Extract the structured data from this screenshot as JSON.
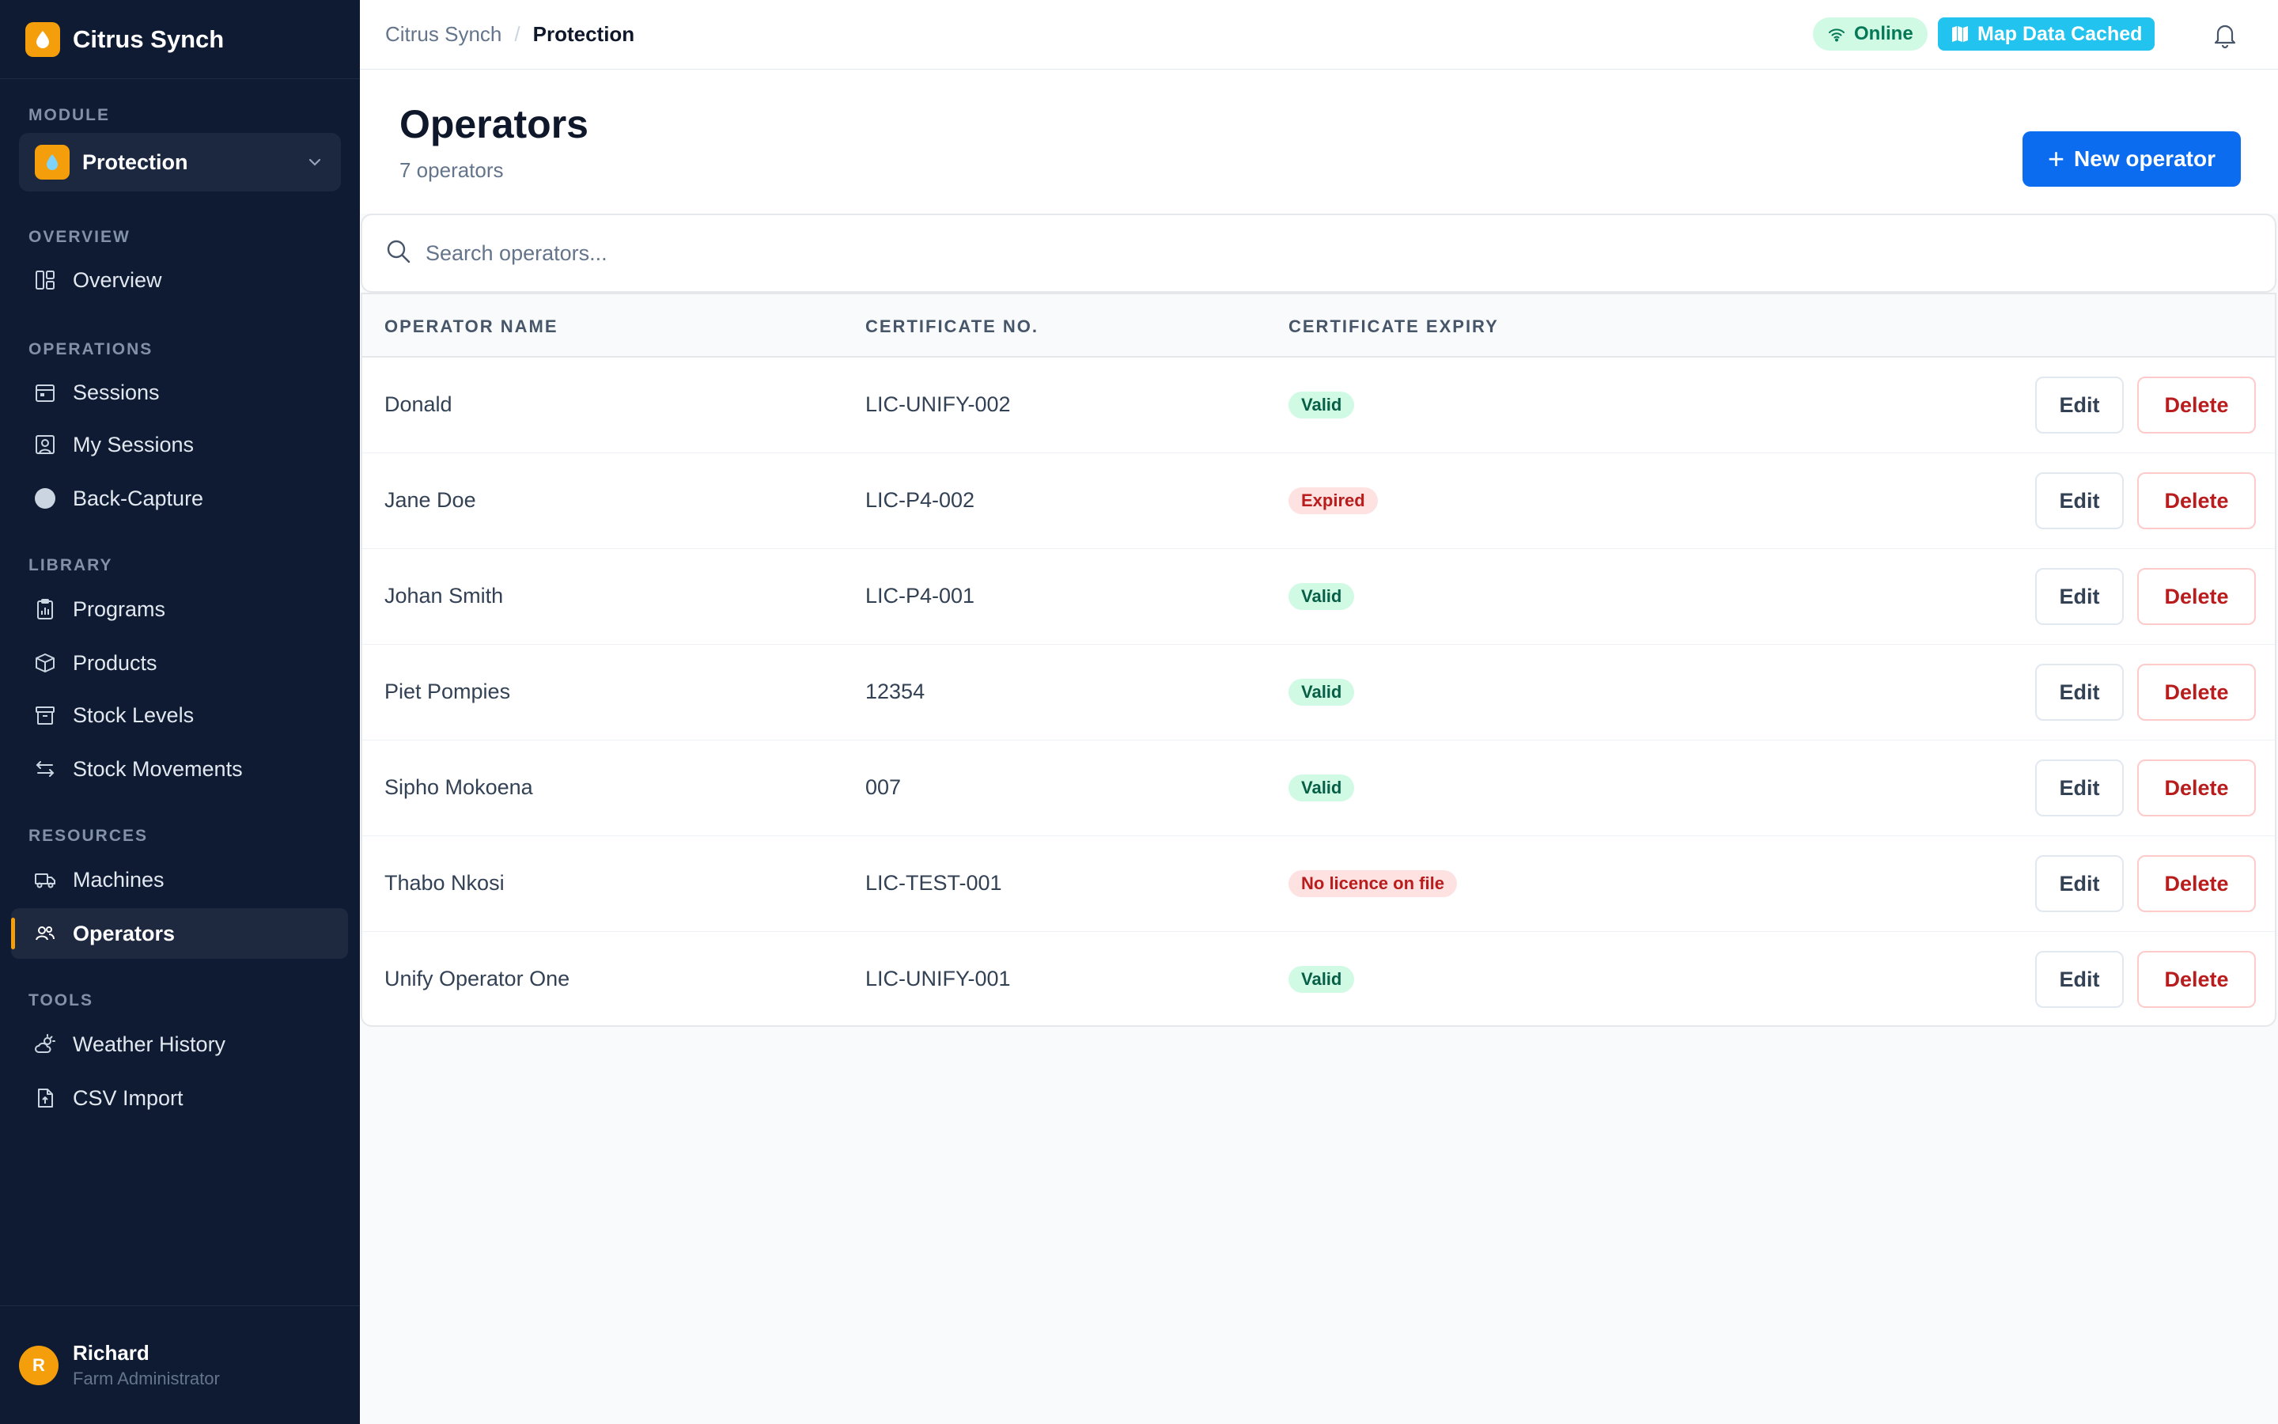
{
  "app": {
    "name": "Citrus Synch"
  },
  "sidebar": {
    "module_label": "MODULE",
    "module_value": "Protection",
    "sections": [
      {
        "label": "OVERVIEW",
        "items": [
          {
            "label": "Overview",
            "icon": "layout-icon"
          }
        ]
      },
      {
        "label": "OPERATIONS",
        "items": [
          {
            "label": "Sessions",
            "icon": "calendar-icon"
          },
          {
            "label": "My Sessions",
            "icon": "user-card-icon"
          },
          {
            "label": "Back-Capture",
            "icon": "circle-icon"
          }
        ]
      },
      {
        "label": "LIBRARY",
        "items": [
          {
            "label": "Programs",
            "icon": "clipboard-chart-icon"
          },
          {
            "label": "Products",
            "icon": "box-icon"
          },
          {
            "label": "Stock Levels",
            "icon": "archive-icon"
          },
          {
            "label": "Stock Movements",
            "icon": "arrows-swap-icon"
          }
        ]
      },
      {
        "label": "RESOURCES",
        "items": [
          {
            "label": "Machines",
            "icon": "truck-icon"
          },
          {
            "label": "Operators",
            "icon": "users-icon",
            "active": true
          }
        ]
      },
      {
        "label": "TOOLS",
        "items": [
          {
            "label": "Weather History",
            "icon": "cloud-sun-icon"
          },
          {
            "label": "CSV Import",
            "icon": "file-upload-icon"
          }
        ]
      }
    ],
    "user": {
      "initial": "R",
      "name": "Richard",
      "role": "Farm Administrator"
    }
  },
  "topbar": {
    "breadcrumb": [
      "Citrus Synch",
      "Protection"
    ],
    "online_label": "Online",
    "map_label": "Map Data Cached"
  },
  "page": {
    "title": "Operators",
    "count": "7 operators",
    "new_button": "New operator"
  },
  "search": {
    "placeholder": "Search operators..."
  },
  "table": {
    "headers": [
      "OPERATOR NAME",
      "CERTIFICATE NO.",
      "CERTIFICATE EXPIRY"
    ],
    "edit_label": "Edit",
    "delete_label": "Delete",
    "rows": [
      {
        "name": "Donald",
        "cert": "LIC-UNIFY-002",
        "status": "Valid",
        "kind": "valid"
      },
      {
        "name": "Jane Doe",
        "cert": "LIC-P4-002",
        "status": "Expired",
        "kind": "expired"
      },
      {
        "name": "Johan Smith",
        "cert": "LIC-P4-001",
        "status": "Valid",
        "kind": "valid"
      },
      {
        "name": "Piet Pompies",
        "cert": "12354",
        "status": "Valid",
        "kind": "valid"
      },
      {
        "name": "Sipho Mokoena",
        "cert": "007",
        "status": "Valid",
        "kind": "valid"
      },
      {
        "name": "Thabo Nkosi",
        "cert": "LIC-TEST-001",
        "status": "No licence on file",
        "kind": "expired"
      },
      {
        "name": "Unify Operator One",
        "cert": "LIC-UNIFY-001",
        "status": "Valid",
        "kind": "valid"
      }
    ]
  },
  "colors": {
    "sidebar_bg": "#0f1b33",
    "accent": "#f59e0b",
    "primary": "#0b6cf0",
    "danger": "#b91c1c",
    "success": "#065f46"
  }
}
